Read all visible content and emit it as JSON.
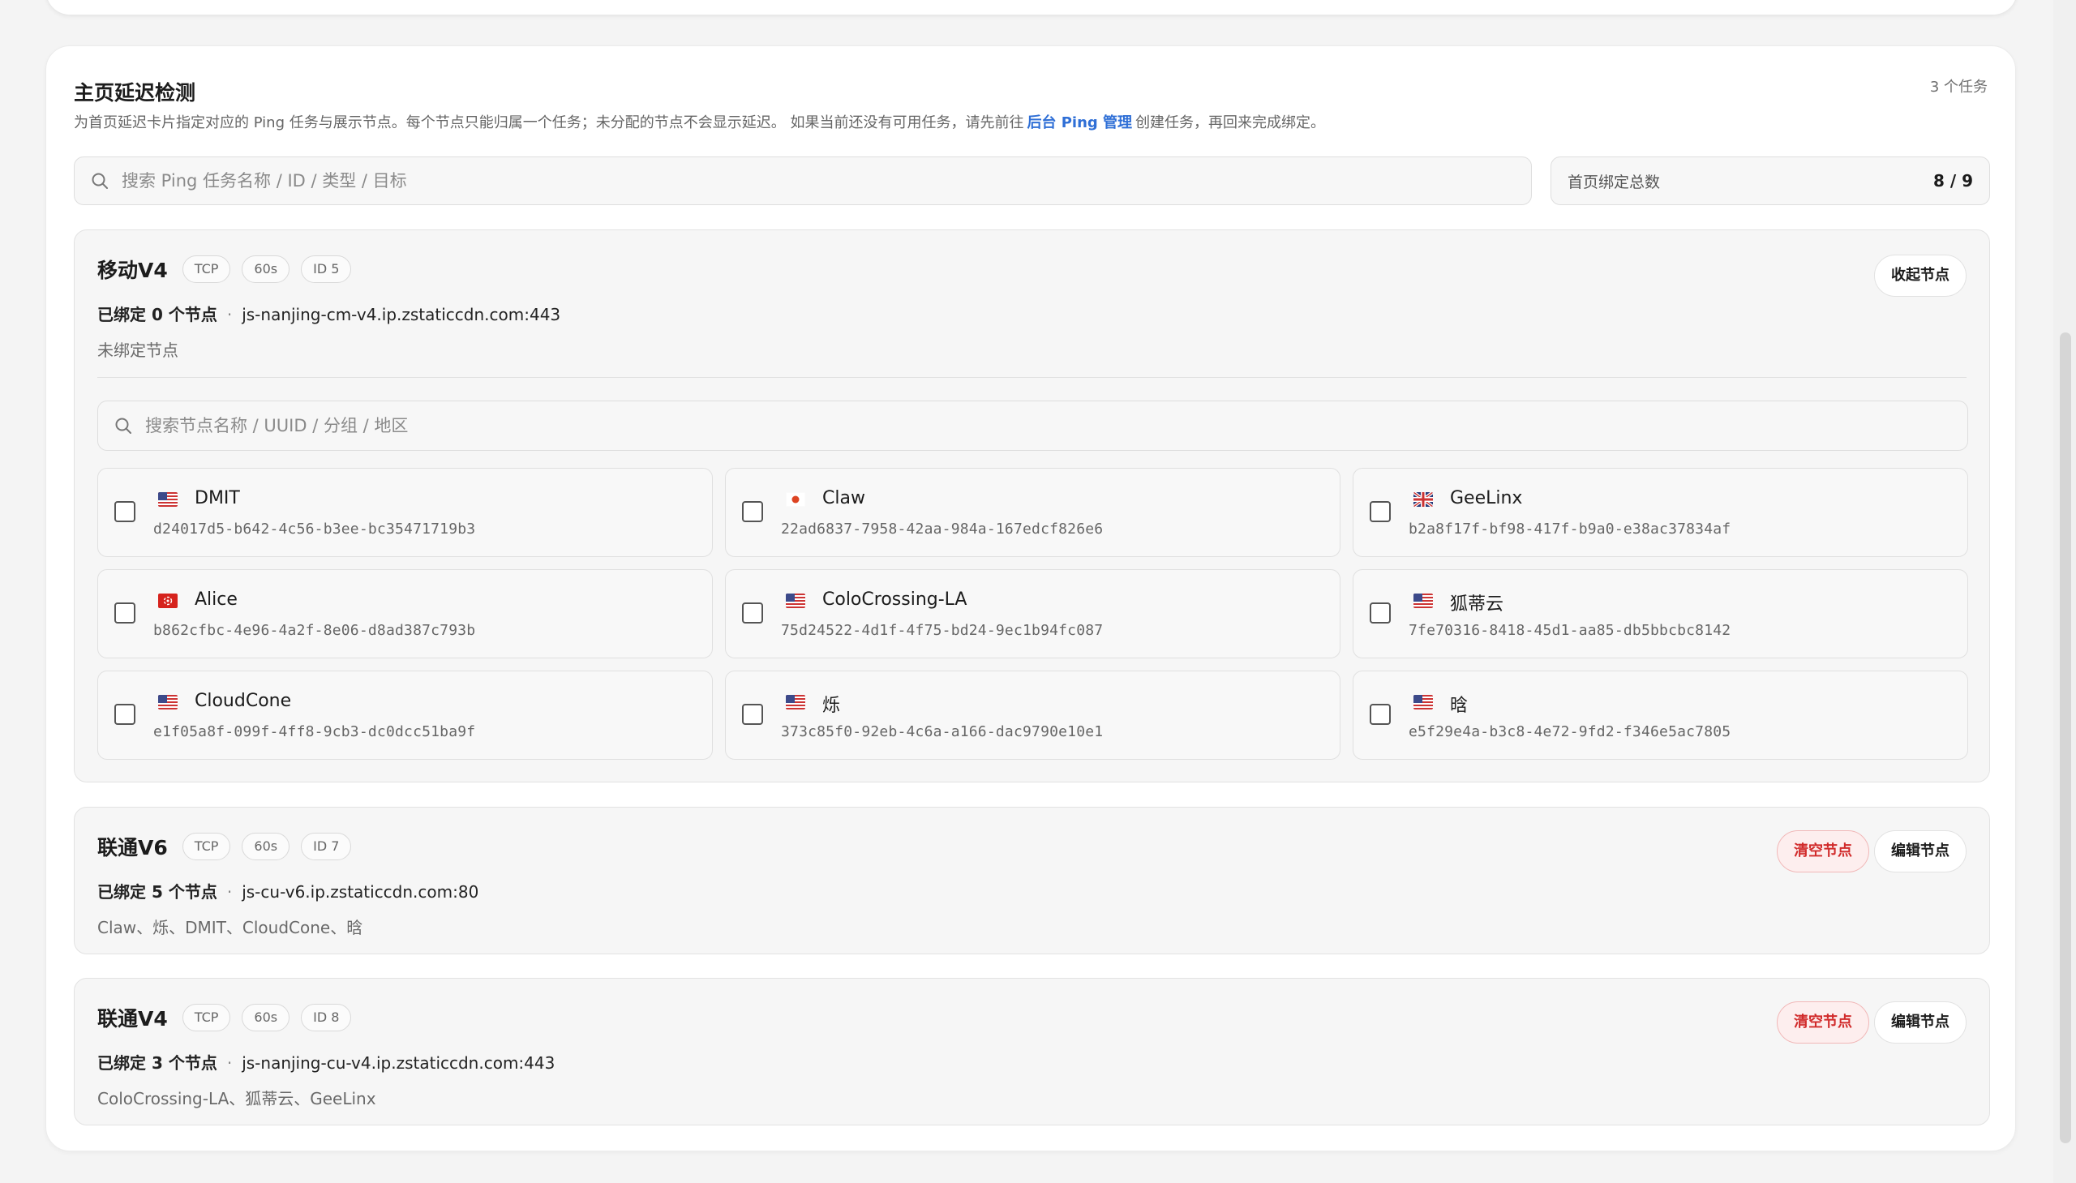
{
  "section": {
    "title": "主页延迟检测",
    "task_count": "3 个任务",
    "description_prefix": "为首页延迟卡片指定对应的 Ping 任务与展示节点。每个节点只能归属一个任务；未分配的节点不会显示延迟。 如果当前还没有可用任务，请先前往",
    "description_link": "后台 Ping 管理",
    "description_suffix": "创建任务，再回来完成绑定。"
  },
  "search": {
    "placeholder": "搜索 Ping 任务名称 / ID / 类型 / 目标"
  },
  "binding_total": {
    "label": "首页绑定总数",
    "value": "8 / 9"
  },
  "tasks": [
    {
      "name": "移动V4",
      "protocol": "TCP",
      "interval": "60s",
      "id": "ID 5",
      "bound": "已绑定 0 个节点",
      "separator": "·",
      "target": "js-nanjing-cm-v4.ip.zstaticcdn.com:443",
      "nodes_text": "未绑定节点",
      "collapse_label": "收起节点",
      "node_search_placeholder": "搜索节点名称 / UUID / 分组 / 地区",
      "nodes": [
        {
          "name": "DMIT",
          "uuid": "d24017d5-b642-4c56-b3ee-bc35471719b3",
          "flag": "us-flag-icon"
        },
        {
          "name": "Claw",
          "uuid": "22ad6837-7958-42aa-984a-167edcf826e6",
          "flag": "jp-flag-icon"
        },
        {
          "name": "GeeLinx",
          "uuid": "b2a8f17f-bf98-417f-b9a0-e38ac37834af",
          "flag": "uk-flag-icon"
        },
        {
          "name": "Alice",
          "uuid": "b862cfbc-4e96-4a2f-8e06-d8ad387c793b",
          "flag": "hk-flag-icon"
        },
        {
          "name": "ColoCrossing-LA",
          "uuid": "75d24522-4d1f-4f75-bd24-9ec1b94fc087",
          "flag": "us-flag-icon"
        },
        {
          "name": "狐蒂云",
          "uuid": "7fe70316-8418-45d1-aa85-db5bbcbc8142",
          "flag": "us-flag-icon"
        },
        {
          "name": "CloudCone",
          "uuid": "e1f05a8f-099f-4ff8-9cb3-dc0dcc51ba9f",
          "flag": "us-flag-icon"
        },
        {
          "name": "烁",
          "uuid": "373c85f0-92eb-4c6a-a166-dac9790e10e1",
          "flag": "us-flag-icon"
        },
        {
          "name": "晗",
          "uuid": "e5f29e4a-b3c8-4e72-9fd2-f346e5ac7805",
          "flag": "us-flag-icon"
        }
      ]
    },
    {
      "name": "联通V6",
      "protocol": "TCP",
      "interval": "60s",
      "id": "ID 7",
      "bound": "已绑定 5 个节点",
      "separator": "·",
      "target": "js-cu-v6.ip.zstaticcdn.com:80",
      "nodes_text": "Claw、烁、DMIT、CloudCone、晗",
      "clear_label": "清空节点",
      "edit_label": "编辑节点"
    },
    {
      "name": "联通V4",
      "protocol": "TCP",
      "interval": "60s",
      "id": "ID 8",
      "bound": "已绑定 3 个节点",
      "separator": "·",
      "target": "js-nanjing-cu-v4.ip.zstaticcdn.com:443",
      "nodes_text": "ColoCrossing-LA、狐蒂云、GeeLinx",
      "clear_label": "清空节点",
      "edit_label": "编辑节点"
    }
  ],
  "colors": {
    "accent_link": "#2f6fd6",
    "danger": "#d12b2b",
    "danger_bg": "#fdeeee"
  }
}
